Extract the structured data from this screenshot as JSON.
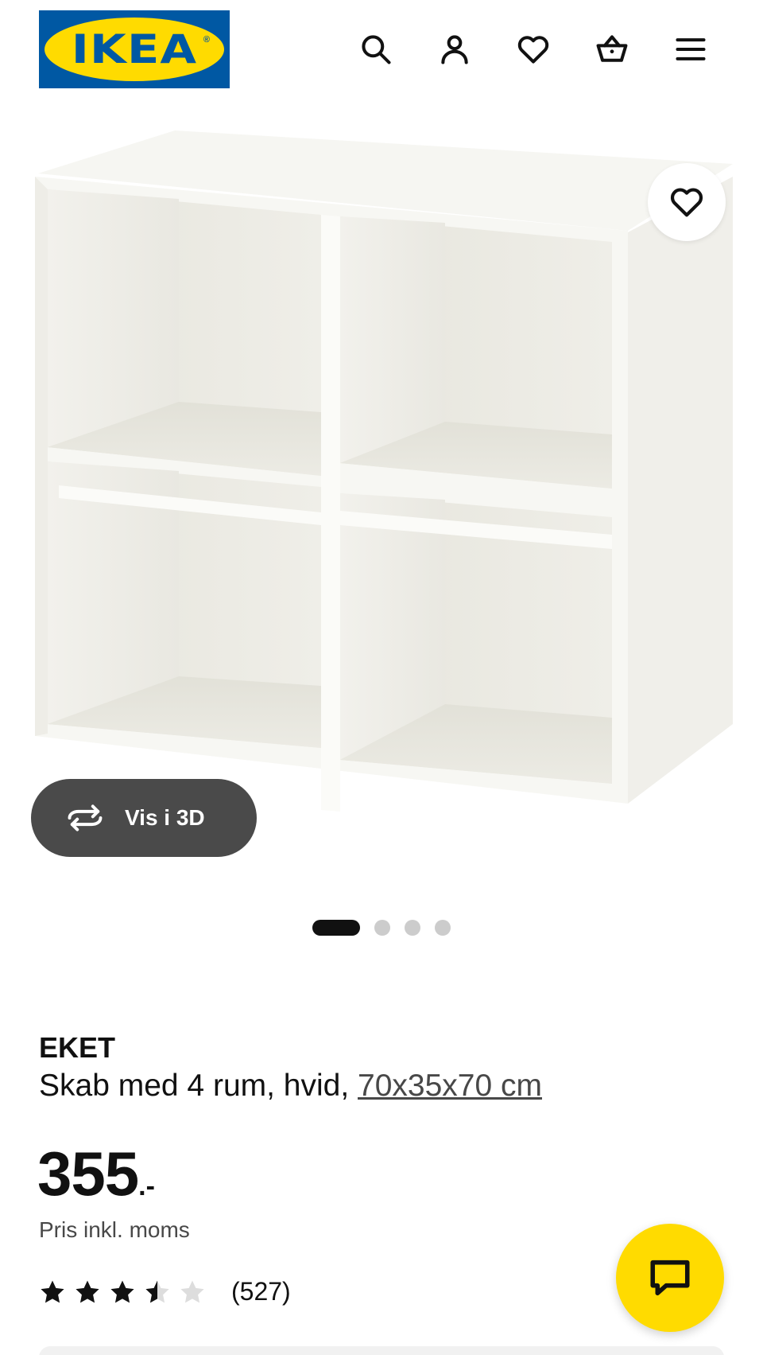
{
  "header": {
    "logo_text": "IKEA",
    "logo_reg": "®",
    "icons": [
      "search-icon",
      "user-icon",
      "heart-icon",
      "basket-icon",
      "menu-icon"
    ]
  },
  "gallery": {
    "view_3d_label": "Vis i 3D",
    "slides_total": 4,
    "active_slide": 1
  },
  "product": {
    "name": "EKET",
    "description": "Skab med 4 rum, hvid, ",
    "dimensions": "70x35x70 cm",
    "price_integer": "355",
    "price_suffix": ".-",
    "price_note": "Pris inkl. moms",
    "rating_value": 3.5,
    "rating_max": 5,
    "rating_count": "(527)"
  },
  "colors": {
    "brand_blue": "#0058a3",
    "brand_yellow": "#ffdb00",
    "text": "#111111",
    "muted": "#484848"
  }
}
